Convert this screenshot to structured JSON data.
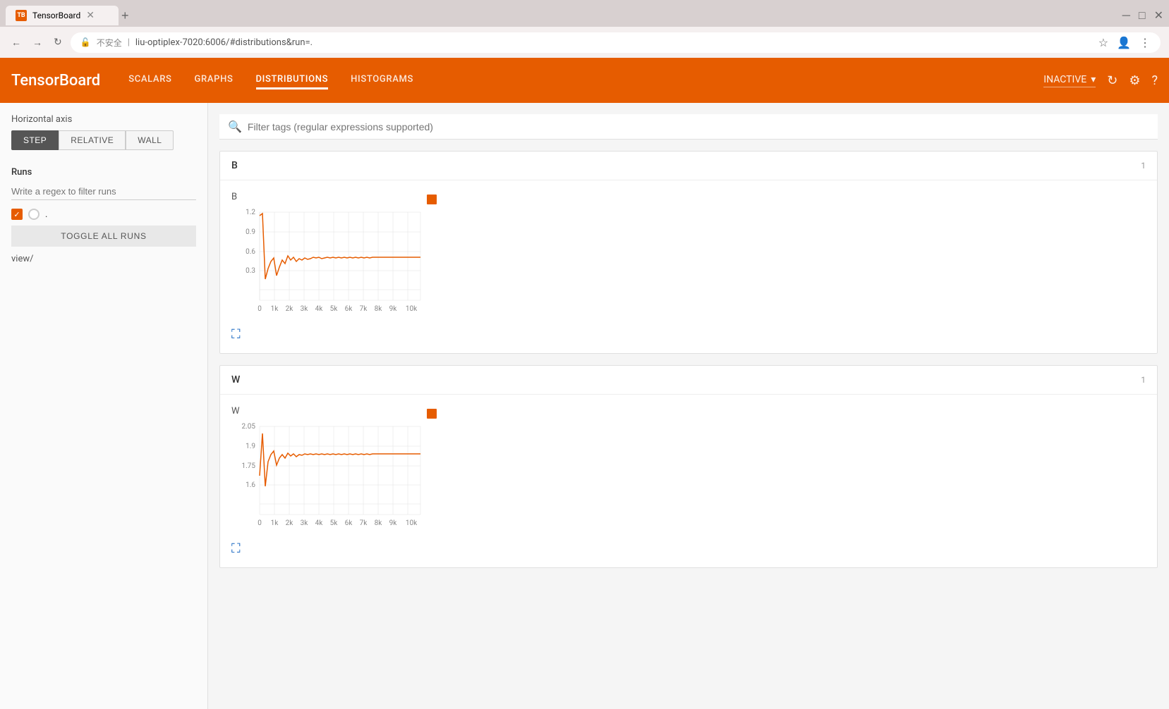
{
  "browser": {
    "tab_title": "TensorBoard",
    "tab_favicon": "TB",
    "address": "liu-optiplex-7020:6006/#distributions&run=.",
    "security_label": "不安全",
    "new_tab_label": "+",
    "nav_back": "←",
    "nav_forward": "→",
    "nav_refresh": "↻"
  },
  "app": {
    "logo": "TensorBoard",
    "nav_items": [
      {
        "label": "SCALARS",
        "active": false
      },
      {
        "label": "GRAPHS",
        "active": false
      },
      {
        "label": "DISTRIBUTIONS",
        "active": true
      },
      {
        "label": "HISTOGRAMS",
        "active": false
      }
    ],
    "status_dropdown": "INACTIVE",
    "refresh_icon": "↻",
    "settings_icon": "⚙",
    "help_icon": "?"
  },
  "sidebar": {
    "horizontal_axis_label": "Horizontal axis",
    "axis_buttons": [
      {
        "label": "STEP",
        "active": true
      },
      {
        "label": "RELATIVE",
        "active": false
      },
      {
        "label": "WALL",
        "active": false
      }
    ],
    "runs_title": "Runs",
    "filter_placeholder": "Write a regex to filter runs",
    "run_item_dot": ".",
    "toggle_all_label": "TOGGLE ALL RUNS",
    "view_link": "view/"
  },
  "filter": {
    "placeholder": "Filter tags (regular expressions supported)"
  },
  "charts": [
    {
      "section_title": "B",
      "section_count": "1",
      "chart_title": "B",
      "y_labels": [
        "1.2",
        "0.9",
        "0.6",
        "0.3"
      ],
      "x_labels": [
        "0",
        "1k",
        "2k",
        "3k",
        "4k",
        "5k",
        "6k",
        "7k",
        "8k",
        "9k",
        "10k"
      ],
      "expand_icon": "⛶"
    },
    {
      "section_title": "W",
      "section_count": "1",
      "chart_title": "W",
      "y_labels": [
        "2.05",
        "1.9",
        "1.75",
        "1.6"
      ],
      "x_labels": [
        "0",
        "1k",
        "2k",
        "3k",
        "4k",
        "5k",
        "6k",
        "7k",
        "8k",
        "9k",
        "10k"
      ],
      "expand_icon": "⛶"
    }
  ]
}
